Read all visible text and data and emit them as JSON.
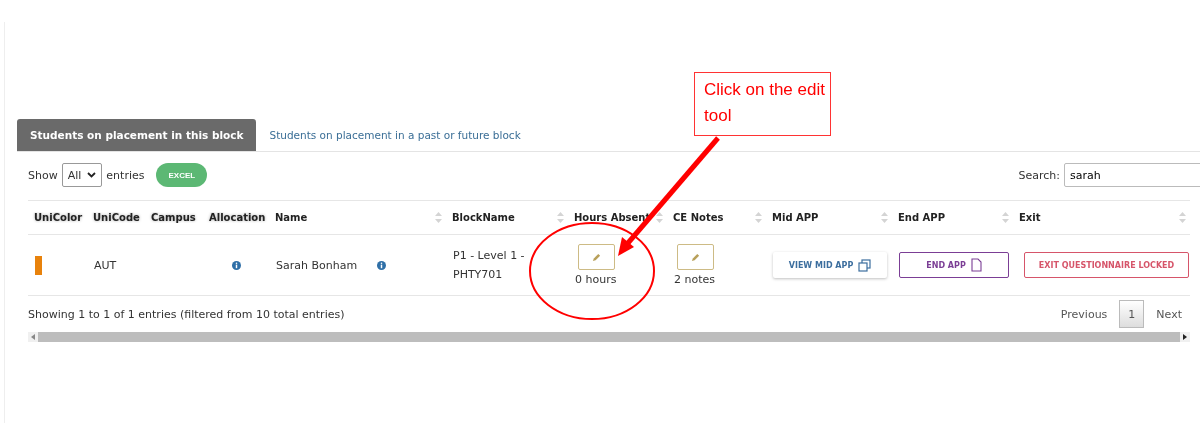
{
  "tabs": [
    {
      "label": "Students on placement in this block",
      "selected": true
    },
    {
      "label": "Students on placement in a past or future block",
      "selected": false
    }
  ],
  "controls": {
    "show_label": "Show",
    "page_size": "All",
    "entries_label": "entries",
    "excel_button": "EXCEL",
    "search_label": "Search:",
    "search_value": "sarah"
  },
  "table": {
    "columns": [
      {
        "label": "UniColor",
        "sortable": false
      },
      {
        "label": "UniCode",
        "sortable": false
      },
      {
        "label": "Campus",
        "sortable": false
      },
      {
        "label": "Allocation",
        "sortable": false
      },
      {
        "label": "Name",
        "sortable": true
      },
      {
        "label": "BlockName",
        "sortable": true
      },
      {
        "label": "Hours Absent",
        "sortable": true
      },
      {
        "label": "CE Notes",
        "sortable": true
      },
      {
        "label": "Mid APP",
        "sortable": true
      },
      {
        "label": "End APP",
        "sortable": true
      },
      {
        "label": "Exit",
        "sortable": true
      }
    ],
    "rows": [
      {
        "color": "#e8820c",
        "unicode": "AUT",
        "name": "Sarah Bonham",
        "block": "P1 - Level 1 - PHTY701",
        "hours": "0 hours",
        "notes": "2 notes",
        "mid_button": "VIEW MID APP",
        "end_button": "END APP",
        "exit_button": "EXIT QUESTIONNAIRE LOCKED"
      }
    ]
  },
  "footer": {
    "info": "Showing 1 to 1 of 1 entries (filtered from 10 total entries)",
    "previous": "Previous",
    "pages": [
      {
        "label": "1",
        "selected": true
      }
    ],
    "next": "Next"
  },
  "annotation": {
    "callout": "Click on the edit tool"
  }
}
